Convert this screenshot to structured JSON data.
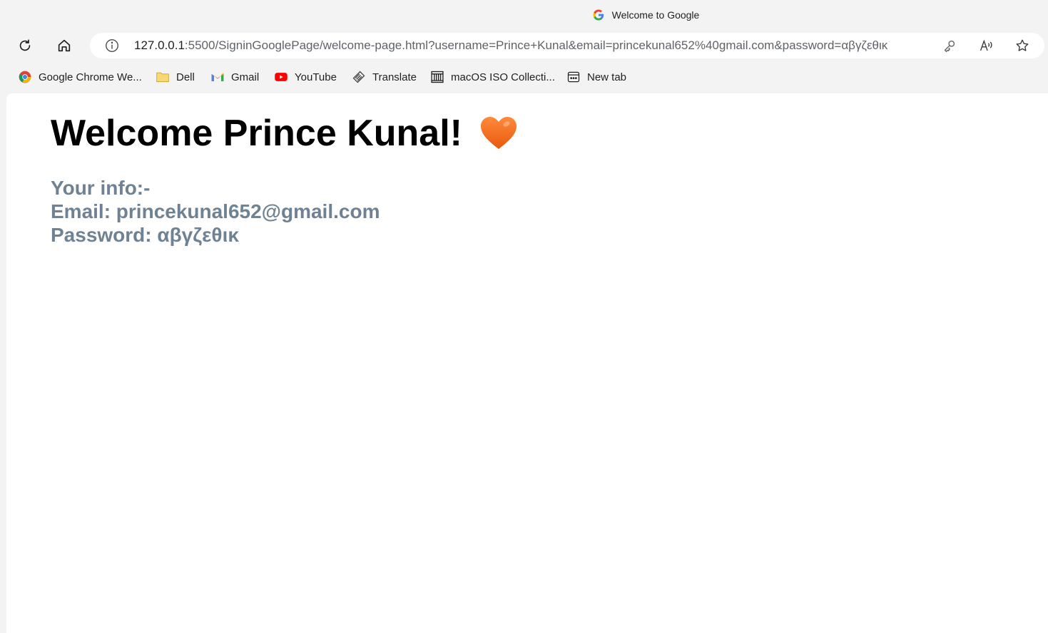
{
  "browser": {
    "tab_title": "Welcome to Google",
    "url_host": "127.0.0.1",
    "url_rest": ":5500/SigninGooglePage/welcome-page.html?username=Prince+Kunal&email=princekunal652%40gmail.com&password=αβγζεθικ",
    "bookmarks": [
      {
        "label": "Google Chrome We...",
        "icon": "chrome-icon"
      },
      {
        "label": "Dell",
        "icon": "folder-icon"
      },
      {
        "label": "Gmail",
        "icon": "gmail-icon"
      },
      {
        "label": "YouTube",
        "icon": "youtube-icon"
      },
      {
        "label": "Translate",
        "icon": "translate-icon"
      },
      {
        "label": "macOS ISO Collecti...",
        "icon": "archive-icon"
      },
      {
        "label": "New tab",
        "icon": "new-tab-icon"
      }
    ]
  },
  "page": {
    "heading": "Welcome Prince Kunal!",
    "info_title": "Your info:-",
    "email_line": "Email: princekunal652@gmail.com",
    "password_line": "Password: αβγζεθικ"
  },
  "colors": {
    "heading": "#000000",
    "info_text": "#6e8294",
    "heart": "#f26b1d",
    "youtube": "#ff0000"
  }
}
